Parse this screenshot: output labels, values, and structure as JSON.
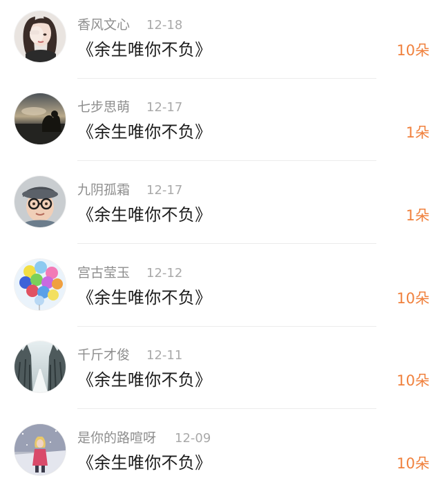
{
  "entries": [
    {
      "name": "香风文心",
      "date": "12-18",
      "title": "《余生唯你不负》",
      "count": "10朵",
      "avatar": "woman-portrait-avatar"
    },
    {
      "name": "七步思萌",
      "date": "12-17",
      "title": "《余生唯你不负》",
      "count": "1朵",
      "avatar": "dusk-landscape-avatar"
    },
    {
      "name": "九阴孤霜",
      "date": "12-17",
      "title": "《余生唯你不负》",
      "count": "1朵",
      "avatar": "child-with-glasses-avatar"
    },
    {
      "name": "宫古莹玉",
      "date": "12-12",
      "title": "《余生唯你不负》",
      "count": "10朵",
      "avatar": "balloons-avatar"
    },
    {
      "name": "千斤才俊",
      "date": "12-11",
      "title": "《余生唯你不负》",
      "count": "10朵",
      "avatar": "snowy-forest-avatar"
    },
    {
      "name": "是你的路喧呀",
      "date": "12-09",
      "title": "《余生唯你不负》",
      "count": "10朵",
      "avatar": "girl-in-snow-avatar"
    }
  ],
  "colors": {
    "name_gray": "#8e8e8e",
    "date_gray": "#a9a9a9",
    "title_black": "#1c1c1c",
    "count_orange": "#f0803c",
    "divider": "#ebebeb"
  }
}
